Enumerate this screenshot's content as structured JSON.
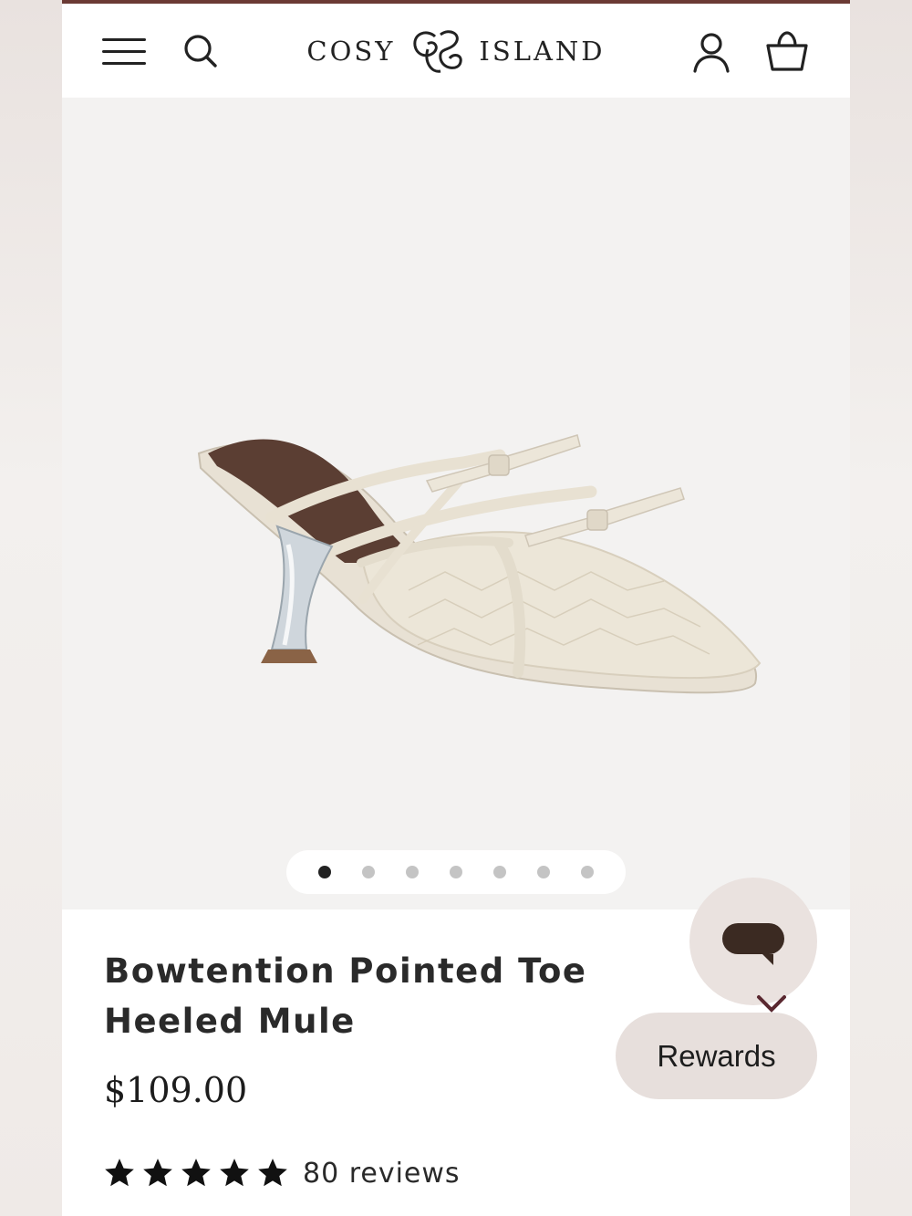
{
  "header": {
    "brand_left": "COSY",
    "brand_right": "ISLAND",
    "icons": [
      "menu-icon",
      "search-icon",
      "logo-monogram",
      "account-icon",
      "cart-icon"
    ]
  },
  "gallery": {
    "image_count": 7,
    "active_index": 0
  },
  "product": {
    "title": "Bowtention Pointed Toe Heeled Mule",
    "price": "$109.00",
    "rating": 5,
    "reviews_label": "80 reviews"
  },
  "widgets": {
    "rewards_label": "Rewards"
  },
  "colors": {
    "accent_bar": "#6b3a34",
    "chat_bubble": "#eae2df",
    "chat_icon": "#3b2a22"
  }
}
